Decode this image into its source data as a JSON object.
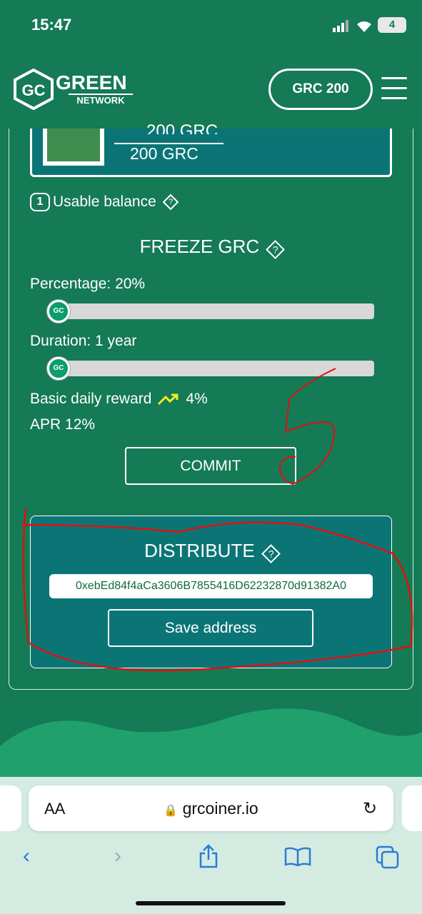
{
  "status": {
    "time": "15:47",
    "battery": "4"
  },
  "header": {
    "logo_title": "GREEN",
    "logo_subtitle": "NETWORK",
    "balance_button": "GRC 200"
  },
  "balance": {
    "top_value": "200 GRC",
    "value": "200 GRC",
    "usable_label": "Usable balance",
    "usable_marker": "1"
  },
  "freeze": {
    "title": "FREEZE GRC",
    "percentage_label": "Percentage: 20%",
    "percentage": 20,
    "duration_label": "Duration: 1 year",
    "duration_value": 0,
    "daily_reward_label": "Basic daily reward",
    "daily_reward_value": "4%",
    "apr": "APR 12%",
    "commit_label": "COMMIT"
  },
  "distribute": {
    "title": "DISTRIBUTE",
    "address": "0xebEd84f4aCa3606B7855416D62232870d91382A0",
    "save_label": "Save address"
  },
  "browser": {
    "aa_label": "AA",
    "url": "grcoiner.io"
  },
  "colors": {
    "background": "#157a56",
    "card": "#0b7576",
    "annotation": "#e01010",
    "trend": "#e8f020"
  }
}
